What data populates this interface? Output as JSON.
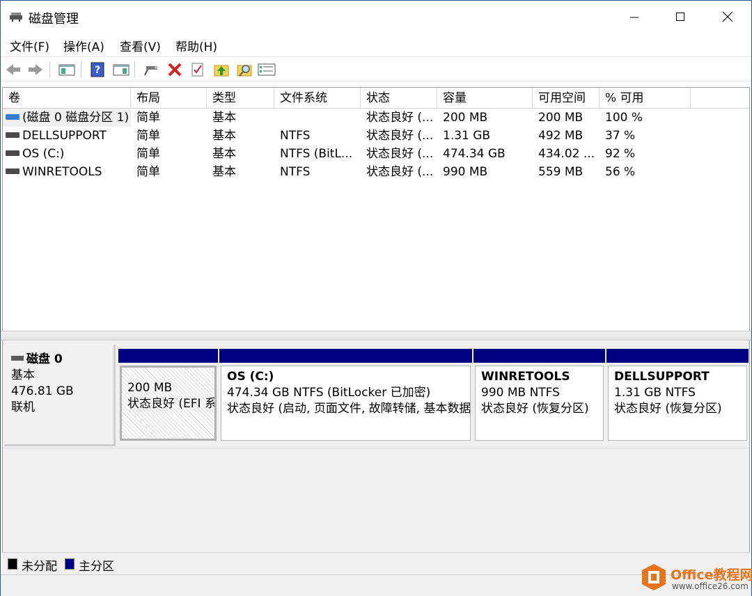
{
  "window": {
    "title": "磁盘管理"
  },
  "menu": [
    "文件(F)",
    "操作(A)",
    "查看(V)",
    "帮助(H)"
  ],
  "toolbar_icons": [
    "back-icon",
    "forward-icon",
    "console-tree-icon",
    "help-icon",
    "properties-panel-icon",
    "connect-icon",
    "delete-icon",
    "check-icon",
    "folder-up-icon",
    "search-folder-icon",
    "settings-list-icon"
  ],
  "volumes": {
    "columns": [
      "卷",
      "布局",
      "类型",
      "文件系统",
      "状态",
      "容量",
      "可用空间",
      "% 可用"
    ],
    "rows": [
      [
        "(磁盘 0 磁盘分区 1)",
        "简单",
        "基本",
        "",
        "状态良好 (...",
        "200 MB",
        "200 MB",
        "100 %"
      ],
      [
        "DELLSUPPORT",
        "简单",
        "基本",
        "NTFS",
        "状态良好 (...",
        "1.31 GB",
        "492 MB",
        "37 %"
      ],
      [
        "OS (C:)",
        "简单",
        "基本",
        "NTFS (BitL...",
        "状态良好 (...",
        "474.34 GB",
        "434.02 ...",
        "92 %"
      ],
      [
        "WINRETOOLS",
        "简单",
        "基本",
        "NTFS",
        "状态良好 (...",
        "990 MB",
        "559 MB",
        "56 %"
      ]
    ]
  },
  "disk": {
    "name": "磁盘 0",
    "type": "基本",
    "size": "476.81 GB",
    "status": "联机",
    "partitions": [
      {
        "title": "",
        "line1": "200 MB",
        "line2": "状态良好 (EFI 系统分区)"
      },
      {
        "title": "OS  (C:)",
        "line1": "474.34 GB NTFS (BitLocker 已加密)",
        "line2": "状态良好 (启动, 页面文件, 故障转储, 基本数据分区)"
      },
      {
        "title": "WINRETOOLS",
        "line1": "990 MB NTFS",
        "line2": "状态良好 (恢复分区)"
      },
      {
        "title": "DELLSUPPORT",
        "line1": "1.31 GB NTFS",
        "line2": "状态良好 (恢复分区)"
      }
    ]
  },
  "legend": [
    {
      "label": "未分配",
      "color": "#000000"
    },
    {
      "label": "主分区",
      "color": "#000080"
    }
  ],
  "watermark": {
    "brand": "Office教程网",
    "url": "www.office26.com"
  },
  "colors": {
    "primary_partition": "#000080",
    "efi_volume_icon": "#3a7bd5",
    "delete_icon": "#d62020"
  }
}
